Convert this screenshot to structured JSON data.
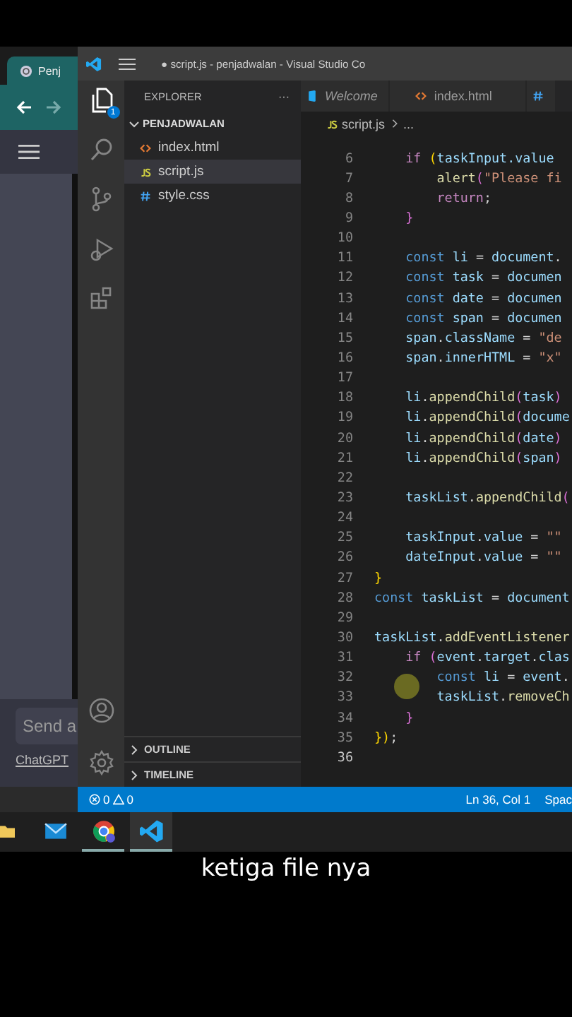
{
  "browser": {
    "tab_title": "Penj",
    "input_placeholder": "Send a",
    "footer_link": "ChatGPT"
  },
  "vscode": {
    "title": "● script.js - penjadwalan - Visual Studio Co",
    "activity_bar": [
      {
        "kind": "explorer",
        "selected": true,
        "badge": "1"
      },
      {
        "kind": "search",
        "selected": false
      },
      {
        "kind": "source-control",
        "selected": false
      },
      {
        "kind": "run",
        "selected": false
      },
      {
        "kind": "extensions",
        "selected": false
      }
    ],
    "activity_bottom": [
      {
        "kind": "account",
        "selected": false
      },
      {
        "kind": "settings",
        "selected": false
      }
    ],
    "explorer": {
      "title": "EXPLORER",
      "more": "···",
      "folder": {
        "name": "PENJADWALAN",
        "expanded": true,
        "children": [
          {
            "name": "index.html",
            "kind": "html",
            "selected": false
          },
          {
            "name": "script.js",
            "kind": "js",
            "selected": true
          },
          {
            "name": "style.css",
            "kind": "css",
            "selected": false
          }
        ]
      },
      "sections": [
        {
          "name": "OUTLINE",
          "expanded": false
        },
        {
          "name": "TIMELINE",
          "expanded": false
        }
      ]
    },
    "tabs": [
      {
        "label": "Welcome",
        "kind": "welcome",
        "selected": false
      },
      {
        "label": "index.html",
        "kind": "html",
        "selected": false
      },
      {
        "kind": "css",
        "selected": false
      }
    ],
    "breadcrumb": [
      "script.js",
      "..."
    ],
    "code_lines": [
      {
        "number": "6",
        "current": false,
        "tokens": [
          {
            "text": "    if ",
            "kind": "ctrl"
          },
          {
            "text": "(",
            "kind": "br"
          },
          {
            "text": "taskInput",
            "kind": "var"
          },
          {
            "text": ".value",
            "kind": "var"
          }
        ]
      },
      {
        "number": "7",
        "current": false,
        "tokens": [
          {
            "text": "        alert",
            "kind": "fn"
          },
          {
            "text": "(",
            "kind": "br2"
          },
          {
            "text": "\"Please fi",
            "kind": "str"
          }
        ]
      },
      {
        "number": "8",
        "current": false,
        "tokens": [
          {
            "text": "        return",
            "kind": "ctrl"
          },
          {
            "text": ";",
            "kind": "pl"
          }
        ]
      },
      {
        "number": "9",
        "current": false,
        "tokens": [
          {
            "text": "    }",
            "kind": "br2"
          }
        ]
      },
      {
        "number": "10",
        "current": false
      },
      {
        "number": "11",
        "current": false,
        "tokens": [
          {
            "text": "    const",
            "kind": "kw"
          },
          {
            "text": " li ",
            "kind": "var"
          },
          {
            "text": "= ",
            "kind": "pl"
          },
          {
            "text": "document",
            "kind": "var"
          },
          {
            "text": ".",
            "kind": "pl"
          }
        ]
      },
      {
        "number": "12",
        "current": false,
        "tokens": [
          {
            "text": "    const",
            "kind": "kw"
          },
          {
            "text": " task ",
            "kind": "var"
          },
          {
            "text": "= ",
            "kind": "pl"
          },
          {
            "text": "documen",
            "kind": "var"
          }
        ]
      },
      {
        "number": "13",
        "current": false,
        "tokens": [
          {
            "text": "    const",
            "kind": "kw"
          },
          {
            "text": " date ",
            "kind": "var"
          },
          {
            "text": "= ",
            "kind": "pl"
          },
          {
            "text": "documen",
            "kind": "var"
          }
        ]
      },
      {
        "number": "14",
        "current": false,
        "tokens": [
          {
            "text": "    const",
            "kind": "kw"
          },
          {
            "text": " span ",
            "kind": "var"
          },
          {
            "text": "= ",
            "kind": "pl"
          },
          {
            "text": "documen",
            "kind": "var"
          }
        ]
      },
      {
        "number": "15",
        "current": false,
        "tokens": [
          {
            "text": "    span",
            "kind": "var"
          },
          {
            "text": ".",
            "kind": "pl"
          },
          {
            "text": "className",
            "kind": "var"
          },
          {
            "text": " = ",
            "kind": "pl"
          },
          {
            "text": "\"de",
            "kind": "str"
          }
        ]
      },
      {
        "number": "16",
        "current": false,
        "tokens": [
          {
            "text": "    span",
            "kind": "var"
          },
          {
            "text": ".",
            "kind": "pl"
          },
          {
            "text": "innerHTML",
            "kind": "var"
          },
          {
            "text": " = ",
            "kind": "pl"
          },
          {
            "text": "\"x\"",
            "kind": "str"
          }
        ]
      },
      {
        "number": "17",
        "current": false
      },
      {
        "number": "18",
        "current": false,
        "tokens": [
          {
            "text": "    li",
            "kind": "var"
          },
          {
            "text": ".",
            "kind": "pl"
          },
          {
            "text": "appendChild",
            "kind": "fn"
          },
          {
            "text": "(",
            "kind": "br2"
          },
          {
            "text": "task",
            "kind": "var"
          },
          {
            "text": ")",
            "kind": "br2"
          }
        ]
      },
      {
        "number": "19",
        "current": false,
        "tokens": [
          {
            "text": "    li",
            "kind": "var"
          },
          {
            "text": ".",
            "kind": "pl"
          },
          {
            "text": "appendChild",
            "kind": "fn"
          },
          {
            "text": "(",
            "kind": "br2"
          },
          {
            "text": "docume",
            "kind": "var"
          }
        ]
      },
      {
        "number": "20",
        "current": false,
        "tokens": [
          {
            "text": "    li",
            "kind": "var"
          },
          {
            "text": ".",
            "kind": "pl"
          },
          {
            "text": "appendChild",
            "kind": "fn"
          },
          {
            "text": "(",
            "kind": "br2"
          },
          {
            "text": "date",
            "kind": "var"
          },
          {
            "text": ")",
            "kind": "br2"
          }
        ]
      },
      {
        "number": "21",
        "current": false,
        "tokens": [
          {
            "text": "    li",
            "kind": "var"
          },
          {
            "text": ".",
            "kind": "pl"
          },
          {
            "text": "appendChild",
            "kind": "fn"
          },
          {
            "text": "(",
            "kind": "br2"
          },
          {
            "text": "span",
            "kind": "var"
          },
          {
            "text": ")",
            "kind": "br2"
          }
        ]
      },
      {
        "number": "22",
        "current": false
      },
      {
        "number": "23",
        "current": false,
        "tokens": [
          {
            "text": "    taskList",
            "kind": "var"
          },
          {
            "text": ".",
            "kind": "pl"
          },
          {
            "text": "appendChild",
            "kind": "fn"
          },
          {
            "text": "(",
            "kind": "br2"
          }
        ]
      },
      {
        "number": "24",
        "current": false
      },
      {
        "number": "25",
        "current": false,
        "tokens": [
          {
            "text": "    taskInput",
            "kind": "var"
          },
          {
            "text": ".",
            "kind": "pl"
          },
          {
            "text": "value",
            "kind": "var"
          },
          {
            "text": " = ",
            "kind": "pl"
          },
          {
            "text": "\"\"",
            "kind": "str"
          }
        ]
      },
      {
        "number": "26",
        "current": false,
        "tokens": [
          {
            "text": "    dateInput",
            "kind": "var"
          },
          {
            "text": ".",
            "kind": "pl"
          },
          {
            "text": "value",
            "kind": "var"
          },
          {
            "text": " = ",
            "kind": "pl"
          },
          {
            "text": "\"\"",
            "kind": "str"
          }
        ]
      },
      {
        "number": "27",
        "current": false,
        "tokens": [
          {
            "text": "}",
            "kind": "br"
          }
        ]
      },
      {
        "number": "28",
        "current": false,
        "tokens": [
          {
            "text": "const",
            "kind": "kw"
          },
          {
            "text": " taskList ",
            "kind": "var"
          },
          {
            "text": "= ",
            "kind": "pl"
          },
          {
            "text": "document",
            "kind": "var"
          }
        ]
      },
      {
        "number": "29",
        "current": false
      },
      {
        "number": "30",
        "current": false,
        "tokens": [
          {
            "text": "taskList",
            "kind": "var"
          },
          {
            "text": ".",
            "kind": "pl"
          },
          {
            "text": "addEventListener",
            "kind": "fn"
          }
        ]
      },
      {
        "number": "31",
        "current": false,
        "tokens": [
          {
            "text": "    if ",
            "kind": "ctrl"
          },
          {
            "text": "(",
            "kind": "br2"
          },
          {
            "text": "event",
            "kind": "var"
          },
          {
            "text": ".",
            "kind": "pl"
          },
          {
            "text": "target",
            "kind": "var"
          },
          {
            "text": ".",
            "kind": "pl"
          },
          {
            "text": "clas",
            "kind": "var"
          }
        ]
      },
      {
        "number": "32",
        "current": false,
        "tokens": [
          {
            "text": "        const",
            "kind": "kw"
          },
          {
            "text": " li ",
            "kind": "var"
          },
          {
            "text": "= ",
            "kind": "pl"
          },
          {
            "text": "event",
            "kind": "var"
          },
          {
            "text": ".",
            "kind": "pl"
          }
        ]
      },
      {
        "number": "33",
        "current": false,
        "tokens": [
          {
            "text": "        taskList",
            "kind": "var"
          },
          {
            "text": ".",
            "kind": "pl"
          },
          {
            "text": "removeCh",
            "kind": "fn"
          }
        ]
      },
      {
        "number": "34",
        "current": false,
        "tokens": [
          {
            "text": "    }",
            "kind": "br2"
          }
        ]
      },
      {
        "number": "35",
        "current": false,
        "tokens": [
          {
            "text": "}",
            "kind": "br"
          },
          {
            "text": ")",
            "kind": "br"
          },
          {
            "text": ";",
            "kind": "pl"
          }
        ]
      },
      {
        "number": "36",
        "current": true
      }
    ],
    "status_bar": {
      "errors": "0",
      "warnings": "0",
      "position": "Ln 36, Col 1",
      "indentation": "Spac"
    }
  },
  "taskbar": [
    {
      "kind": "folder",
      "selected": false,
      "open": false
    },
    {
      "kind": "mail",
      "selected": false,
      "open": false
    },
    {
      "kind": "browser",
      "selected": false,
      "open": true
    },
    {
      "kind": "editor",
      "selected": true,
      "open": true
    }
  ],
  "caption": "ketiga file nya"
}
